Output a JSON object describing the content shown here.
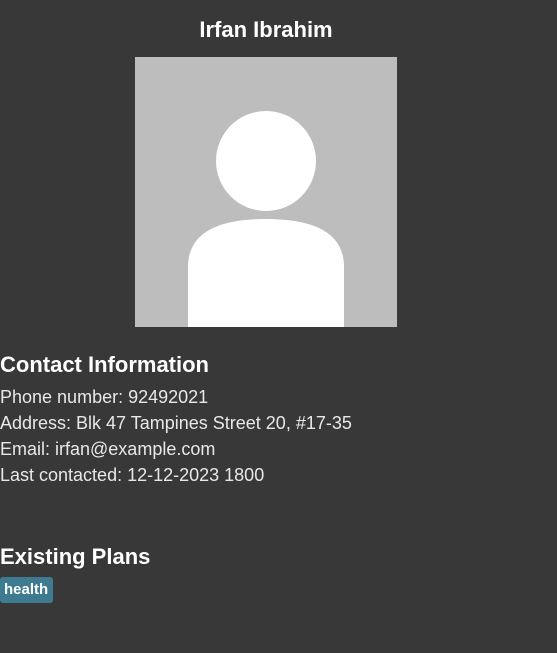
{
  "profile": {
    "name": "Irfan Ibrahim",
    "avatar_icon": "person-silhouette-icon"
  },
  "contact": {
    "title": "Contact Information",
    "phone": "Phone number: 92492021",
    "address": "Address: Blk 47 Tampines Street 20, #17-35",
    "email": "Email: irfan@example.com",
    "last_contacted": "Last contacted: 12-12-2023 1800"
  },
  "plans": {
    "title": "Existing Plans",
    "tags": [
      "health"
    ]
  },
  "colors": {
    "background": "#383838",
    "avatar_background": "#bdbdbd",
    "tag_background": "#3e7b91"
  }
}
